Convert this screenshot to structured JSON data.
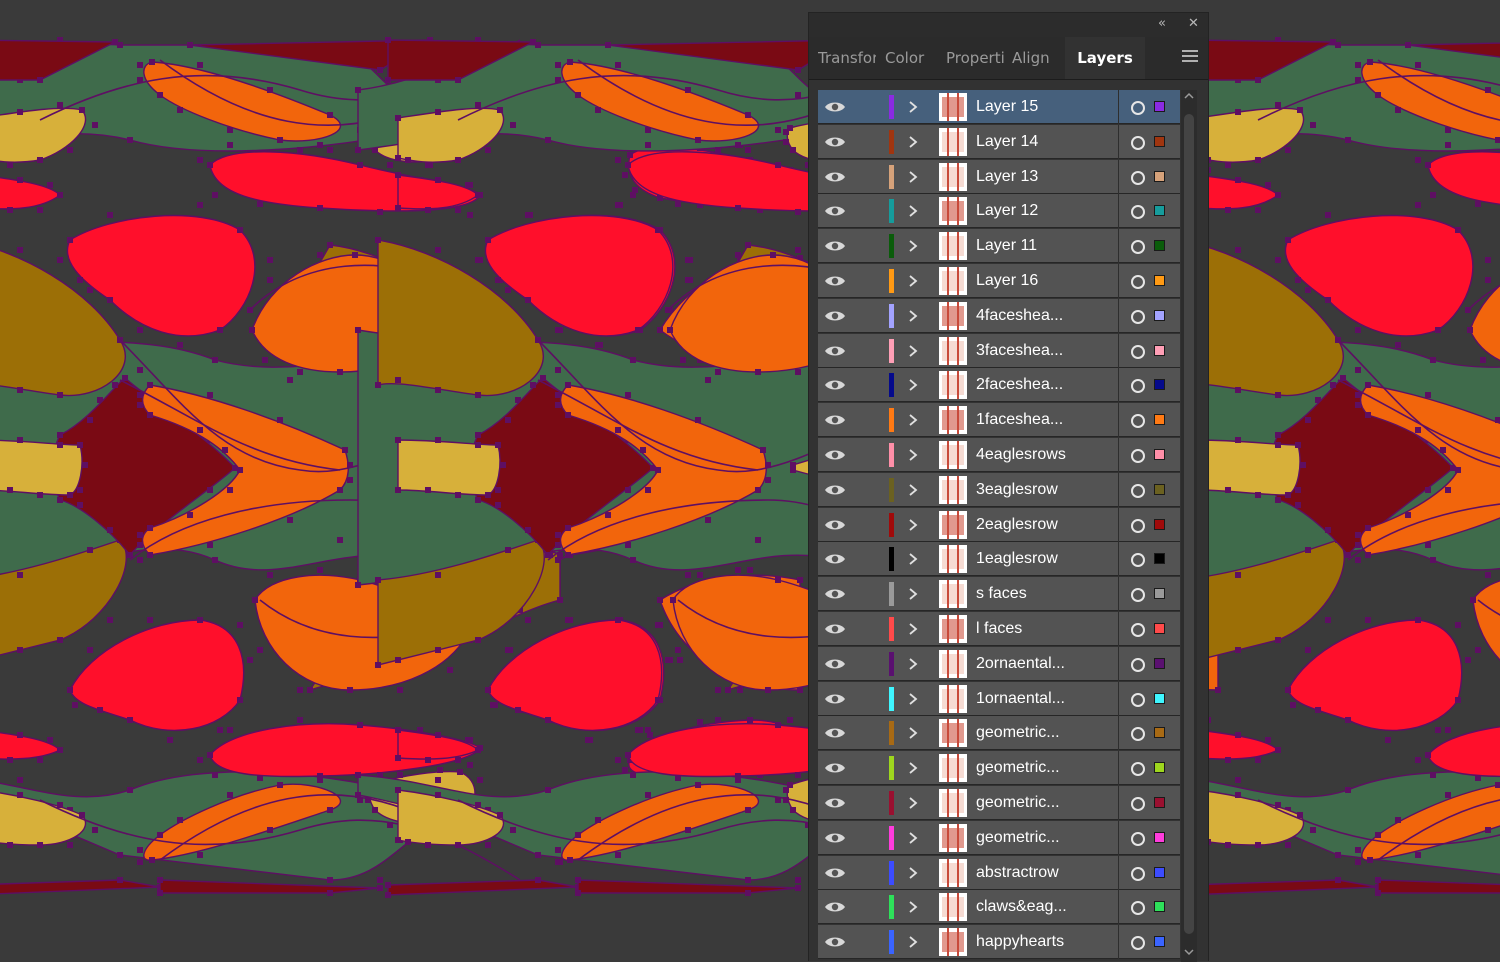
{
  "colors": {
    "canvas_bg": "#3a3a3a",
    "green": "#3f6b4b",
    "maroon": "#7a0a14",
    "orange": "#f2650c",
    "red": "#ff0f2b",
    "mustard": "#d7b03a",
    "olive": "#9c6f06",
    "anchor": "#5e0f63"
  },
  "panel": {
    "collapse_icon": "double-chevron-left-icon",
    "close_icon": "close-icon",
    "menu_icon": "hamburger-menu-icon",
    "tabs": [
      {
        "label": "Transform",
        "active": false
      },
      {
        "label": "Color",
        "active": false
      },
      {
        "label": "Properties",
        "active": false
      },
      {
        "label": "Align",
        "active": false
      },
      {
        "label": "Layers",
        "active": true
      }
    ]
  },
  "layers": [
    {
      "name": "Layer 15",
      "color": "#8a2be2",
      "selected": true
    },
    {
      "name": "Layer 14",
      "color": "#a0350f",
      "selected": false
    },
    {
      "name": "Layer 13",
      "color": "#d6a27a",
      "selected": false
    },
    {
      "name": "Layer 12",
      "color": "#169c9c",
      "selected": false
    },
    {
      "name": "Layer 11",
      "color": "#0a5c0a",
      "selected": false
    },
    {
      "name": "Layer 16",
      "color": "#ff9a14",
      "selected": false
    },
    {
      "name": "4faceshea...",
      "color": "#a3a3ff",
      "selected": false
    },
    {
      "name": "3faceshea...",
      "color": "#ff9fb6",
      "selected": false
    },
    {
      "name": "2faceshea...",
      "color": "#050a8c",
      "selected": false
    },
    {
      "name": "1faceshea...",
      "color": "#ff7a14",
      "selected": false
    },
    {
      "name": "4eaglesrows",
      "color": "#ff8fa8",
      "selected": false
    },
    {
      "name": "3eaglesrow",
      "color": "#6b6120",
      "selected": false
    },
    {
      "name": "2eaglesrow",
      "color": "#a00a0a",
      "selected": false
    },
    {
      "name": "1eaglesrow",
      "color": "#000000",
      "selected": false
    },
    {
      "name": "s faces",
      "color": "#9a9a9a",
      "selected": false
    },
    {
      "name": "l faces",
      "color": "#ff4a4a",
      "selected": false
    },
    {
      "name": "2ornaental...",
      "color": "#5a1070",
      "selected": false
    },
    {
      "name": "1ornaental...",
      "color": "#3ff6ff",
      "selected": false
    },
    {
      "name": "geometric...",
      "color": "#a86a14",
      "selected": false
    },
    {
      "name": "geometric...",
      "color": "#9ed61e",
      "selected": false
    },
    {
      "name": "geometric...",
      "color": "#9a1030",
      "selected": false
    },
    {
      "name": "geometric...",
      "color": "#ff3cdc",
      "selected": false
    },
    {
      "name": "abstractrow",
      "color": "#3c4cff",
      "selected": false
    },
    {
      "name": "claws&eag...",
      "color": "#2ee05a",
      "selected": false
    },
    {
      "name": "happyhearts",
      "color": "#3a64ff",
      "selected": false
    }
  ]
}
